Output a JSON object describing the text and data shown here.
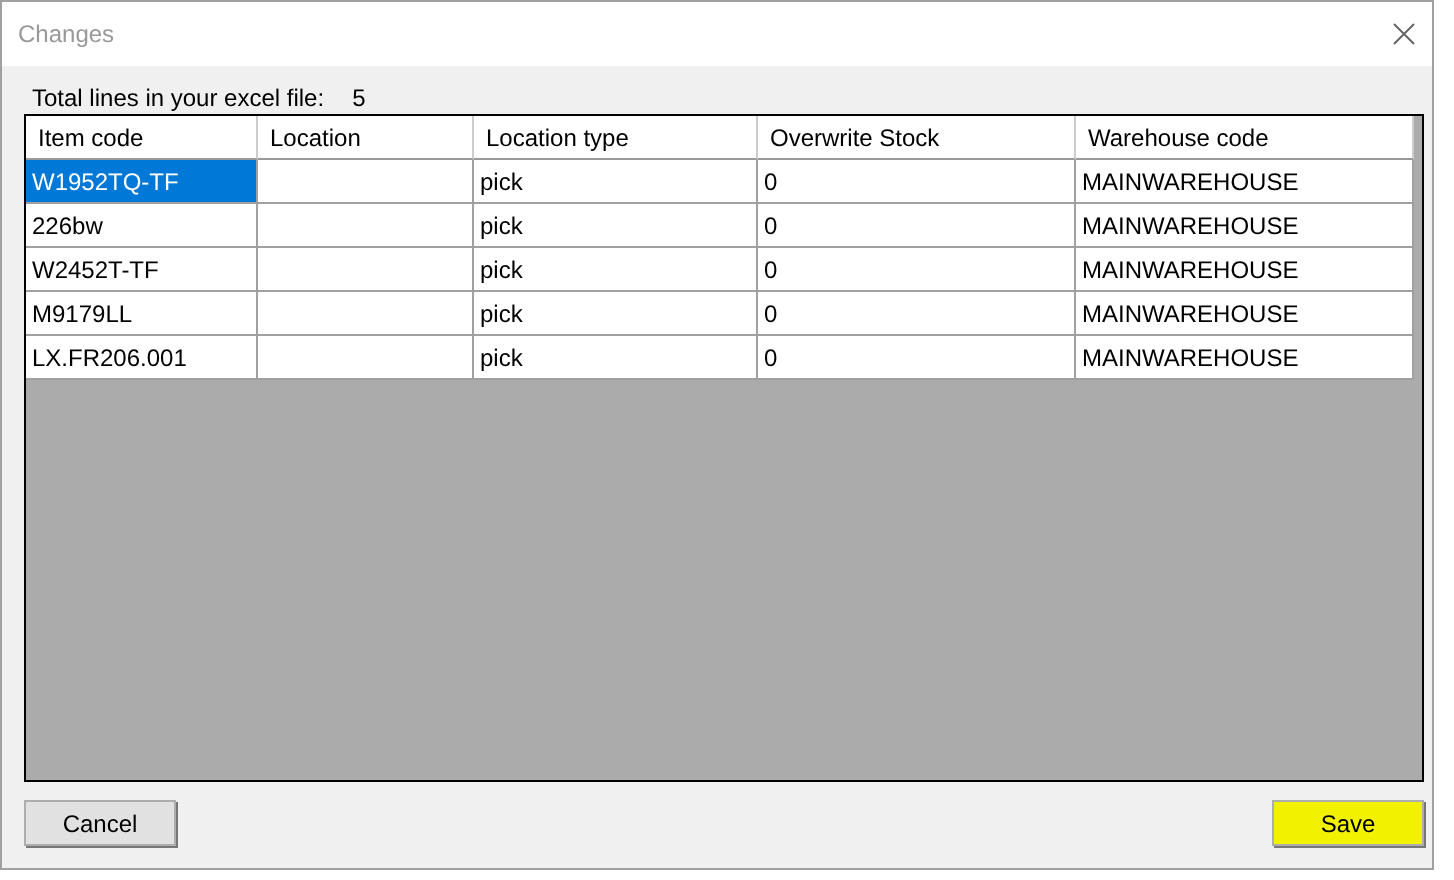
{
  "window": {
    "title": "Changes"
  },
  "summary": {
    "label": "Total lines in your excel file:",
    "value": "5"
  },
  "table": {
    "columns": [
      "Item code",
      "Location",
      "Location type",
      "Overwrite Stock",
      "Warehouse code"
    ],
    "rows": [
      {
        "cells": [
          {
            "text": "W1952TQ-TF",
            "selected": true
          },
          {
            "text": "",
            "selected": false
          },
          {
            "text": "pick",
            "selected": false
          },
          {
            "text": "0",
            "selected": false
          },
          {
            "text": "MAINWAREHOUSE",
            "selected": false
          }
        ]
      },
      {
        "cells": [
          {
            "text": "226bw",
            "selected": false
          },
          {
            "text": "",
            "selected": false
          },
          {
            "text": "pick",
            "selected": false
          },
          {
            "text": "0",
            "selected": false
          },
          {
            "text": "MAINWAREHOUSE",
            "selected": false
          }
        ]
      },
      {
        "cells": [
          {
            "text": "W2452T-TF",
            "selected": false
          },
          {
            "text": "",
            "selected": false
          },
          {
            "text": "pick",
            "selected": false
          },
          {
            "text": "0",
            "selected": false
          },
          {
            "text": "MAINWAREHOUSE",
            "selected": false
          }
        ]
      },
      {
        "cells": [
          {
            "text": "M9179LL",
            "selected": false
          },
          {
            "text": "",
            "selected": false
          },
          {
            "text": "pick",
            "selected": false
          },
          {
            "text": "0",
            "selected": false
          },
          {
            "text": "MAINWAREHOUSE",
            "selected": false
          }
        ]
      },
      {
        "cells": [
          {
            "text": "LX.FR206.001",
            "selected": false
          },
          {
            "text": "",
            "selected": false
          },
          {
            "text": "pick",
            "selected": false
          },
          {
            "text": "0",
            "selected": false
          },
          {
            "text": "MAINWAREHOUSE",
            "selected": false
          }
        ]
      }
    ]
  },
  "buttons": [
    {
      "label": "Cancel",
      "highlighted": false
    },
    {
      "label": "Save",
      "highlighted": true
    }
  ]
}
